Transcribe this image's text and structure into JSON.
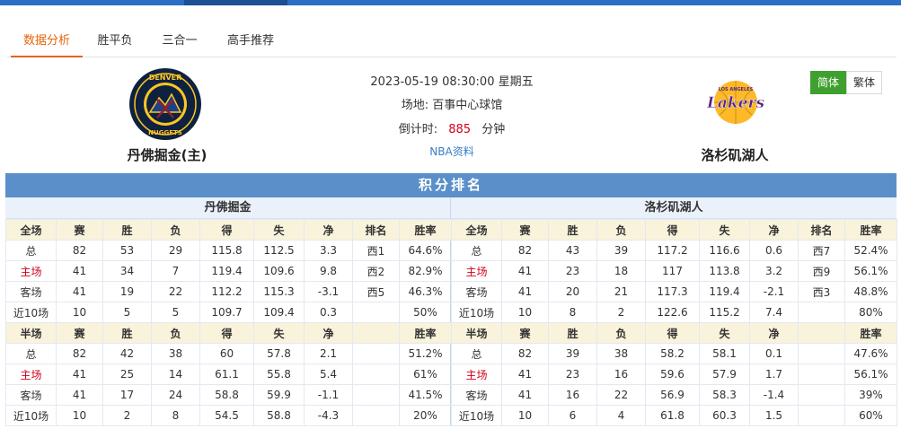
{
  "tabs": [
    "数据分析",
    "胜平负",
    "三合一",
    "高手推荐"
  ],
  "match": {
    "datetime": "2023-05-19 08:30:00 星期五",
    "venue_label": "场地:",
    "venue": "百事中心球馆",
    "countdown_label": "倒计时:",
    "countdown_value": "885",
    "countdown_unit": "分钟",
    "nba_link": "NBA资料",
    "home_team": "丹佛掘金(主)",
    "away_team": "洛杉矶湖人",
    "home_logo_text_top": "DENVER",
    "home_logo_text_bottom": "NUGGETS",
    "away_logo_text_top": "LOS ANGELES",
    "away_logo_text": "Lakers"
  },
  "lang": {
    "simplified": "简体",
    "traditional": "繁体"
  },
  "colors": {
    "accent": "#e8630a",
    "header_blue": "#5b8fc9",
    "red": "#d0021b",
    "green": "#3fa02f"
  },
  "standings": {
    "title": "积分排名",
    "teams": [
      {
        "name": "丹佛掘金",
        "full_header": [
          "全场",
          "赛",
          "胜",
          "负",
          "得",
          "失",
          "净",
          "排名",
          "胜率"
        ],
        "full_rows": [
          [
            "总",
            "82",
            "53",
            "29",
            "115.8",
            "112.5",
            "3.3",
            "西1",
            "64.6%"
          ],
          [
            "主场",
            "41",
            "34",
            "7",
            "119.4",
            "109.6",
            "9.8",
            "西2",
            "82.9%"
          ],
          [
            "客场",
            "41",
            "19",
            "22",
            "112.2",
            "115.3",
            "-3.1",
            "西5",
            "46.3%"
          ],
          [
            "近10场",
            "10",
            "5",
            "5",
            "109.7",
            "109.4",
            "0.3",
            "",
            "50%"
          ]
        ],
        "half_header": [
          "半场",
          "赛",
          "胜",
          "负",
          "得",
          "失",
          "净",
          "",
          "胜率"
        ],
        "half_rows": [
          [
            "总",
            "82",
            "42",
            "38",
            "60",
            "57.8",
            "2.1",
            "",
            "51.2%"
          ],
          [
            "主场",
            "41",
            "25",
            "14",
            "61.1",
            "55.8",
            "5.4",
            "",
            "61%"
          ],
          [
            "客场",
            "41",
            "17",
            "24",
            "58.8",
            "59.9",
            "-1.1",
            "",
            "41.5%"
          ],
          [
            "近10场",
            "10",
            "2",
            "8",
            "54.5",
            "58.8",
            "-4.3",
            "",
            "20%"
          ]
        ]
      },
      {
        "name": "洛杉矶湖人",
        "full_header": [
          "全场",
          "赛",
          "胜",
          "负",
          "得",
          "失",
          "净",
          "排名",
          "胜率"
        ],
        "full_rows": [
          [
            "总",
            "82",
            "43",
            "39",
            "117.2",
            "116.6",
            "0.6",
            "西7",
            "52.4%"
          ],
          [
            "主场",
            "41",
            "23",
            "18",
            "117",
            "113.8",
            "3.2",
            "西9",
            "56.1%"
          ],
          [
            "客场",
            "41",
            "20",
            "21",
            "117.3",
            "119.4",
            "-2.1",
            "西3",
            "48.8%"
          ],
          [
            "近10场",
            "10",
            "8",
            "2",
            "122.6",
            "115.2",
            "7.4",
            "",
            "80%"
          ]
        ],
        "half_header": [
          "半场",
          "赛",
          "胜",
          "负",
          "得",
          "失",
          "净",
          "",
          "胜率"
        ],
        "half_rows": [
          [
            "总",
            "82",
            "39",
            "38",
            "58.2",
            "58.1",
            "0.1",
            "",
            "47.6%"
          ],
          [
            "主场",
            "41",
            "23",
            "16",
            "59.6",
            "57.9",
            "1.7",
            "",
            "56.1%"
          ],
          [
            "客场",
            "41",
            "16",
            "22",
            "56.9",
            "58.3",
            "-1.4",
            "",
            "39%"
          ],
          [
            "近10场",
            "10",
            "6",
            "4",
            "61.8",
            "60.3",
            "1.5",
            "",
            "60%"
          ]
        ]
      }
    ]
  }
}
